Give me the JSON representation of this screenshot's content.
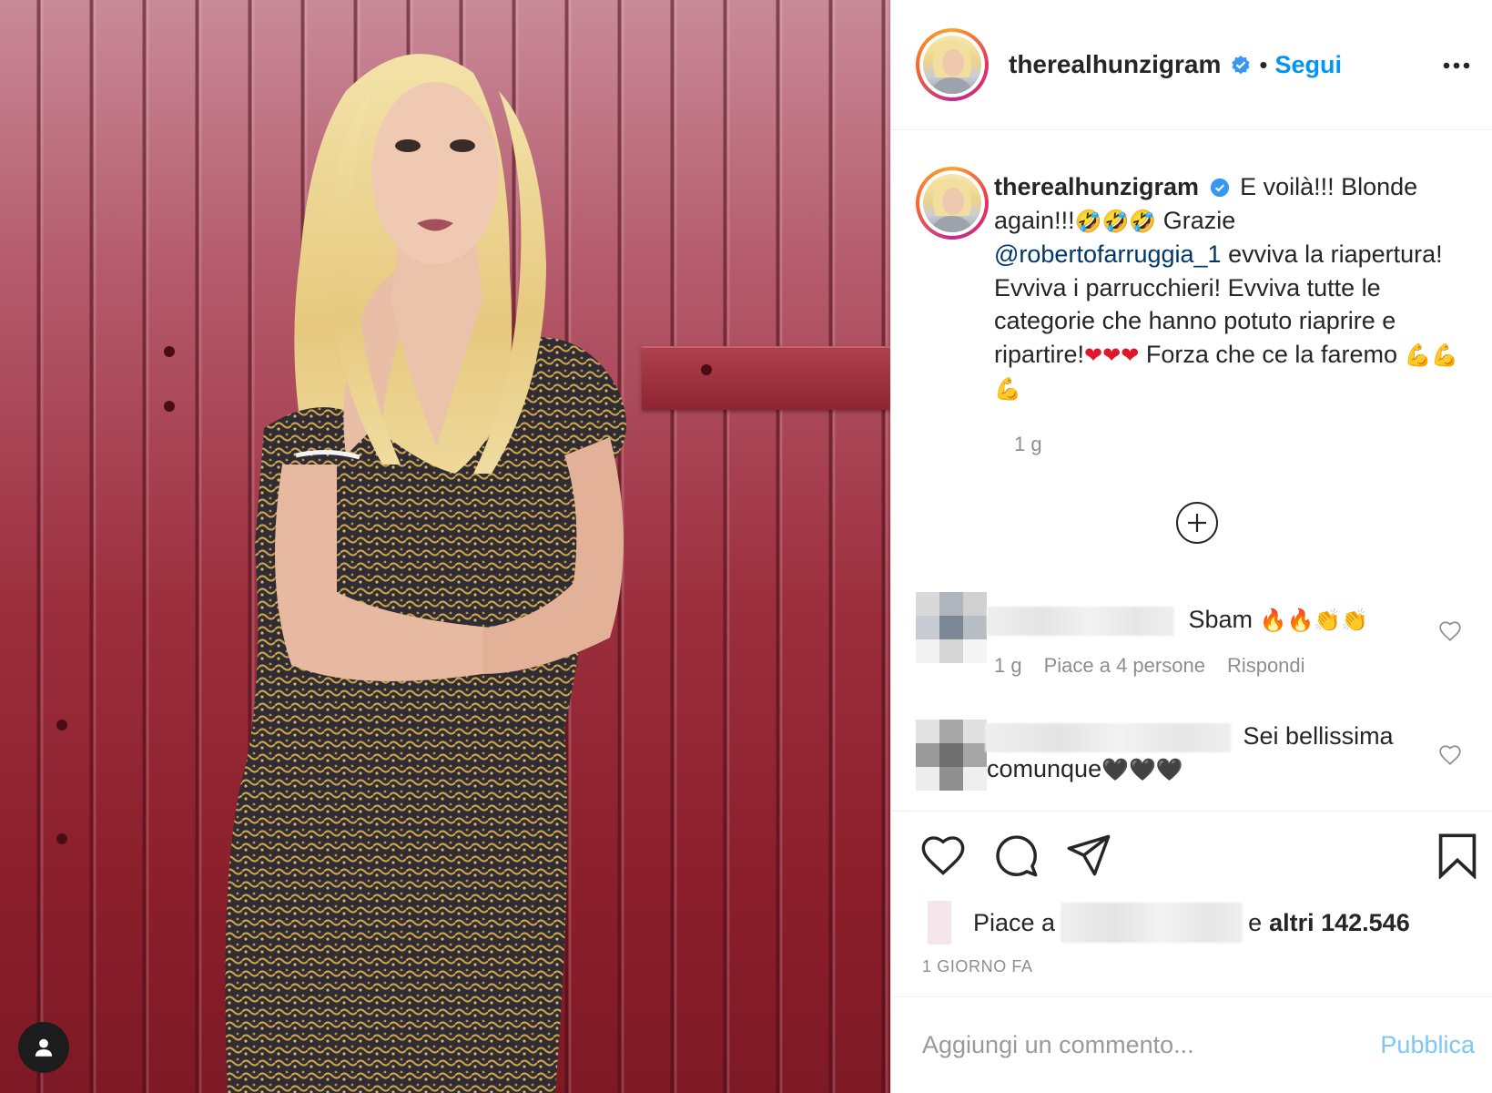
{
  "post": {
    "username": "therealhunzigram",
    "follow_label": "Segui",
    "dot": "•",
    "more_icon": "more-options-icon"
  },
  "caption": {
    "username": "therealhunzigram",
    "text_1": "E voilà!!! Blonde again!!!",
    "emoji_1": "🤣🤣🤣",
    "text_2": " Grazie ",
    "mention": "@robertofarruggia_1",
    "text_3": " evviva la riapertura! Evviva i parrucchieri! Evviva tutte le categorie che hanno potuto riaprire e ripartire!",
    "emoji_2": "❤❤❤",
    "text_4": " Forza che ce la faremo ",
    "emoji_3": "💪💪💪",
    "time": "1 g"
  },
  "comments": [
    {
      "text": "Sbam ",
      "emoji": "🔥🔥👏👏",
      "time": "1 g",
      "likes": "Piace a 4 persone",
      "reply": "Rispondi"
    },
    {
      "text": "Sei bellissima comunque",
      "emoji": "🖤🖤🖤"
    }
  ],
  "likes": {
    "prefix": "Piace a",
    "middle": "e",
    "count": "altri 142.546"
  },
  "date": "1 GIORNO FA",
  "add_comment": {
    "placeholder": "Aggiungi un commento...",
    "publish_label": "Pubblica"
  },
  "colors": {
    "accent": "#0095f6",
    "mention": "#00376b",
    "muted": "#8e8e8e",
    "wall": "#9c2f3e"
  }
}
